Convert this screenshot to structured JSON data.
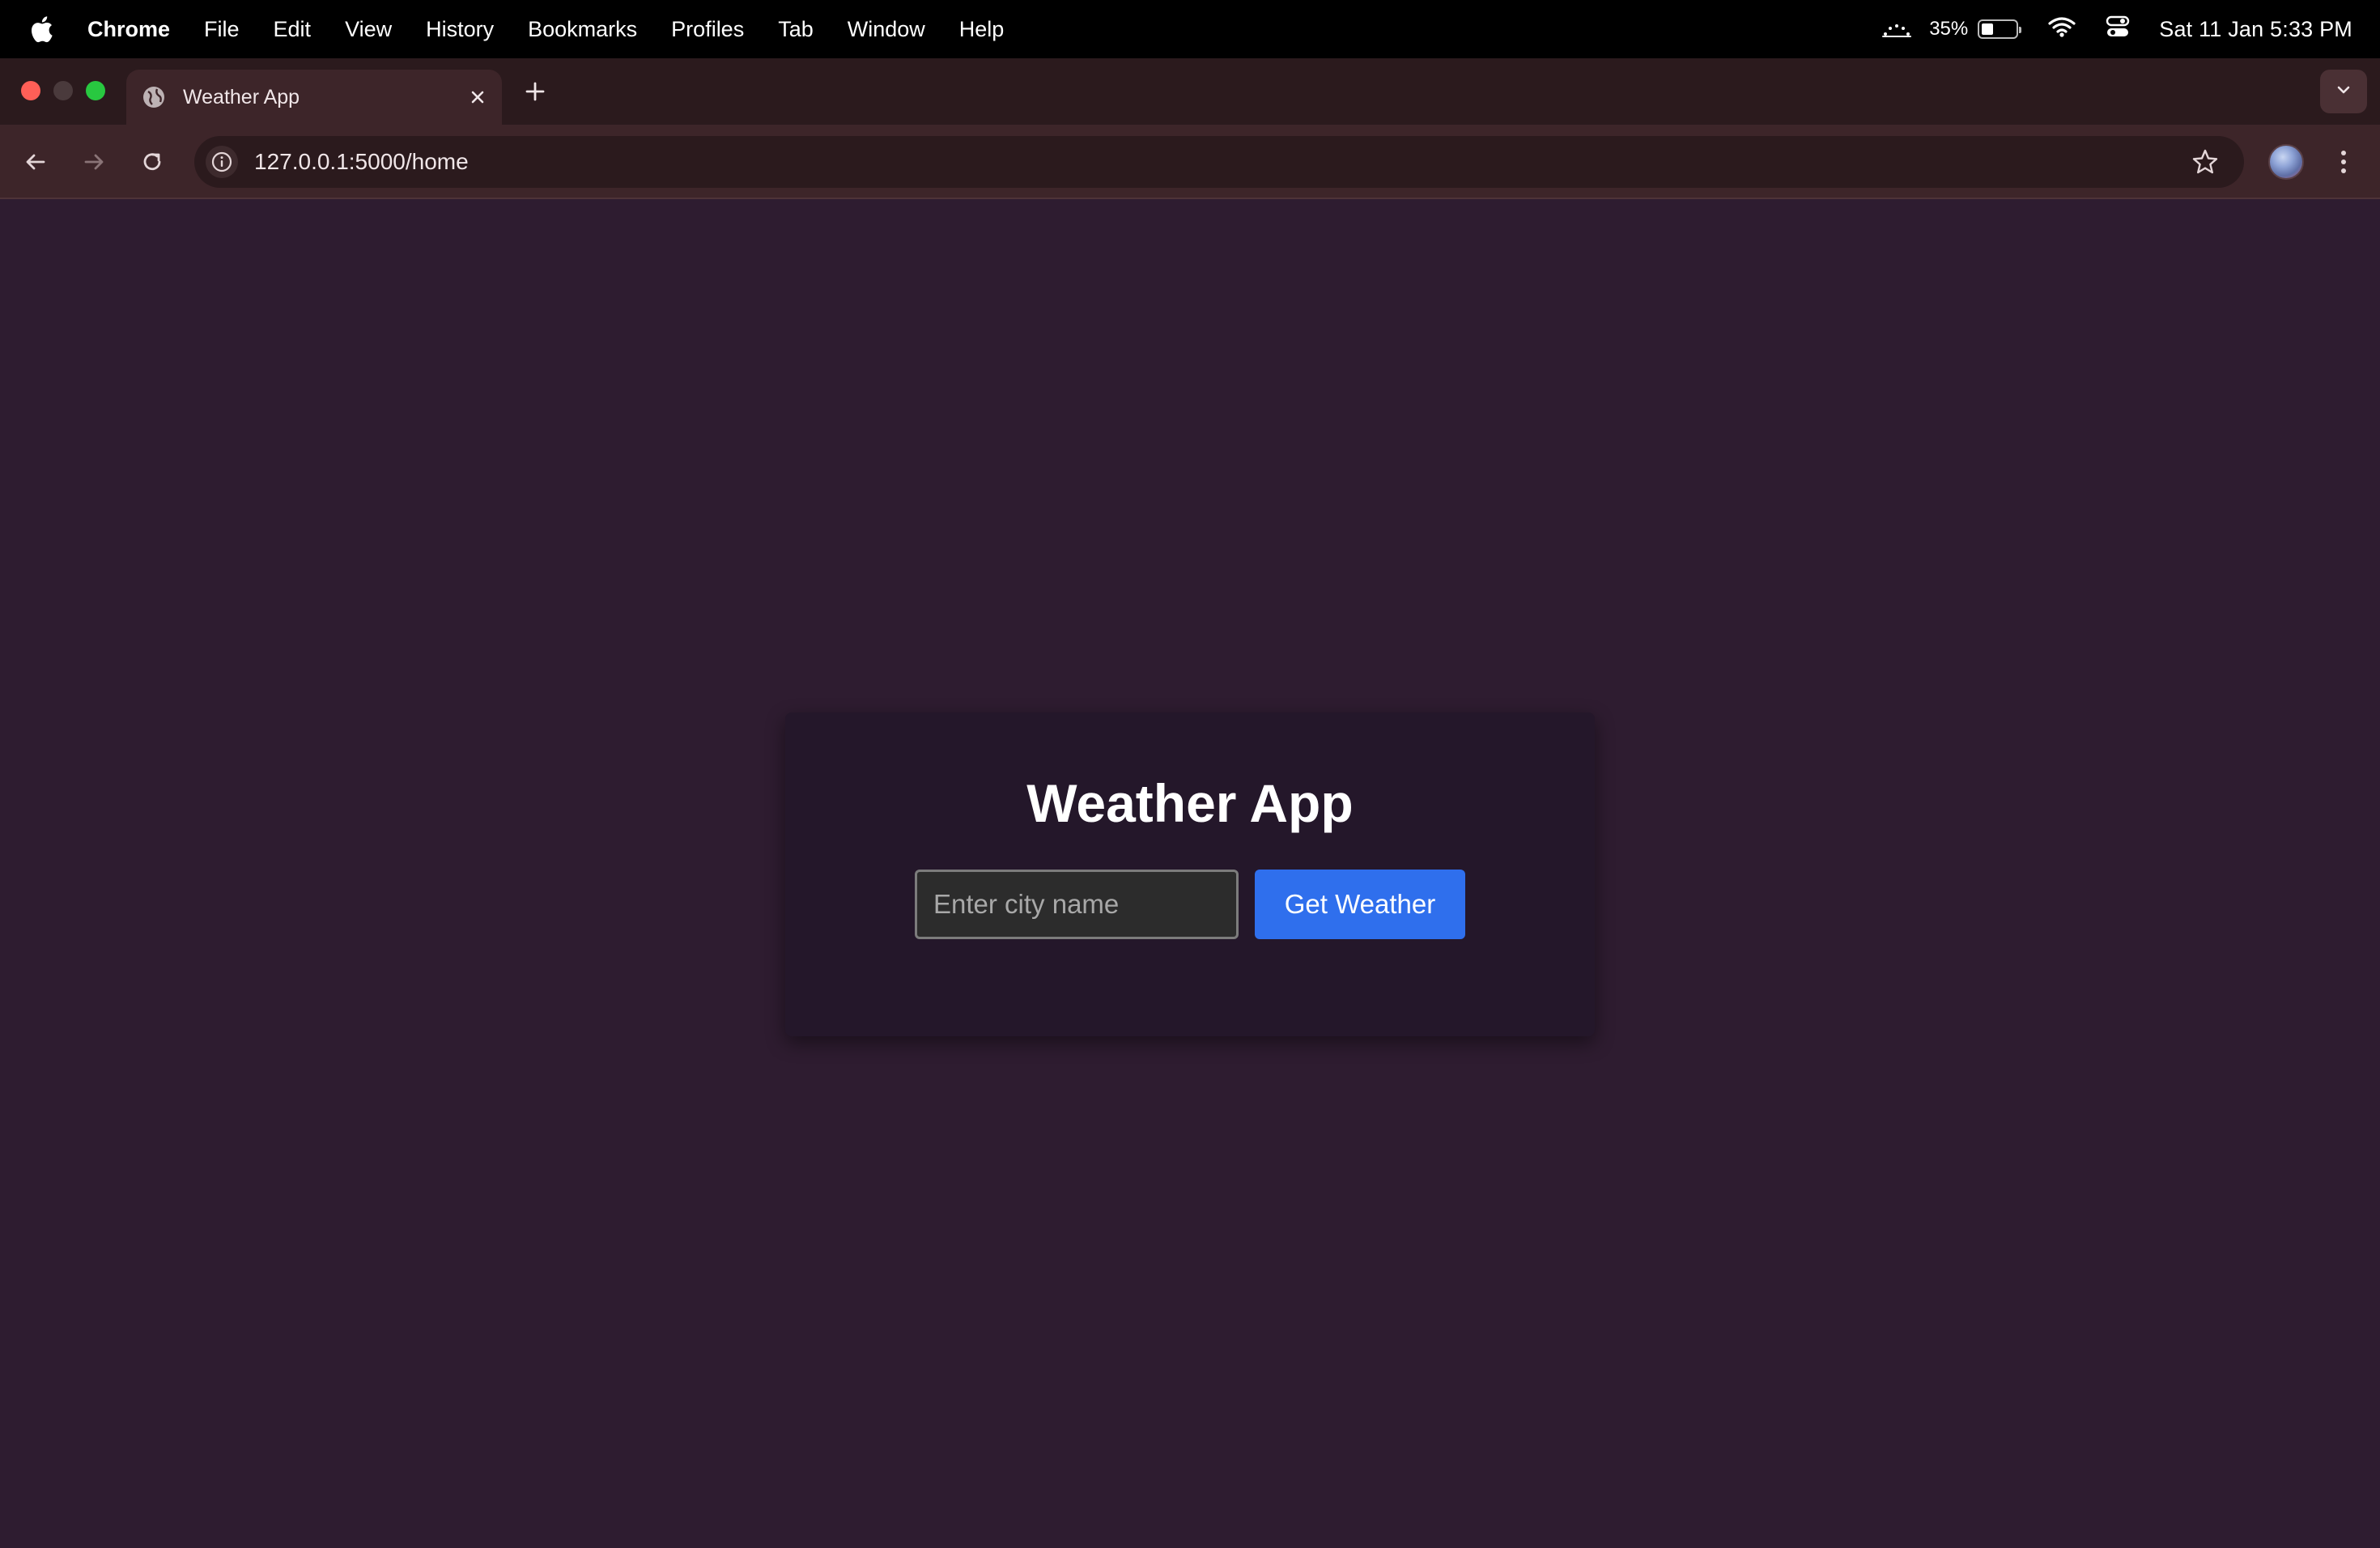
{
  "menubar": {
    "app_name": "Chrome",
    "items": [
      "File",
      "Edit",
      "View",
      "History",
      "Bookmarks",
      "Profiles",
      "Tab",
      "Window",
      "Help"
    ],
    "battery_percent": "35%",
    "battery_level": 0.35,
    "clock": "Sat 11 Jan  5:33 PM"
  },
  "browser": {
    "tab_title": "Weather App",
    "url": "127.0.0.1:5000/home"
  },
  "app": {
    "title": "Weather App",
    "city_input": {
      "placeholder": "Enter city name",
      "value": ""
    },
    "submit_label": "Get Weather"
  },
  "colors": {
    "page_background": "#2e1c30",
    "card_background": "#24172a",
    "button_accent": "#2f6fed"
  },
  "icons": [
    "apple-icon",
    "brightness-icon",
    "battery-icon",
    "wifi-icon",
    "control-center-icon",
    "globe-icon",
    "close-icon",
    "plus-icon",
    "chevron-down-icon",
    "back-arrow-icon",
    "forward-arrow-icon",
    "reload-icon",
    "info-icon",
    "star-icon",
    "kebab-menu-icon"
  ]
}
